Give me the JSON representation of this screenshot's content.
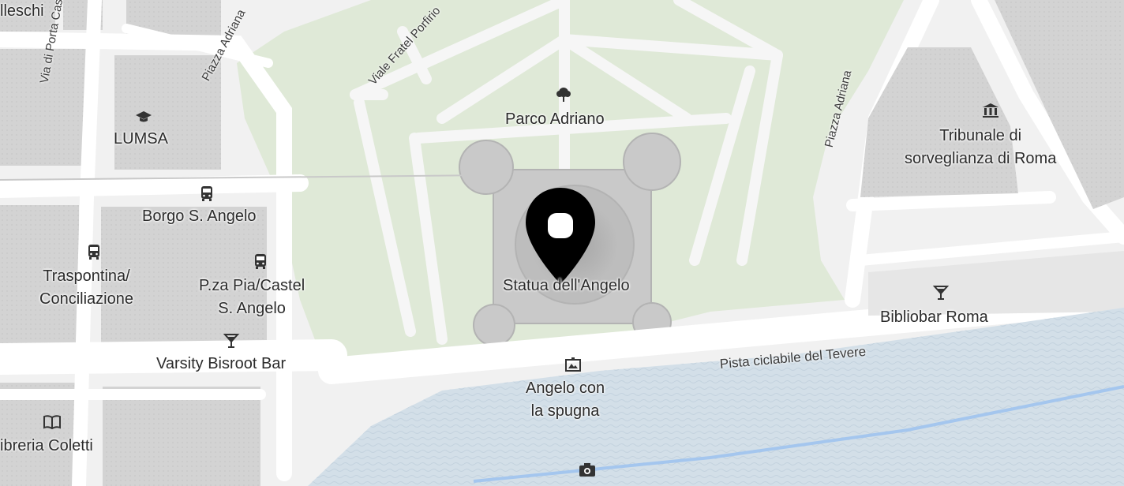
{
  "map": {
    "selected_place": "Statua dell'Angelo",
    "places": {
      "parco": "Parco Adriano",
      "statua": "Statua dell'Angelo",
      "lumsa": "LUMSA",
      "borgo": "Borgo S. Angelo",
      "traspontina": "Traspontina/\nConciliazione",
      "pzapia": "P.za Pia/Castel\nS. Angelo",
      "varsity": "Varsity Bisroot Bar",
      "angelo_spugna": "Angelo con\nla spugna",
      "libreria": "ibreria Coletti",
      "tribunale": "Tribunale di\nsorveglianza di Roma",
      "bibliobar": "Bibliobar Roma",
      "lleschi": "lleschi"
    },
    "roads": {
      "porta_castello": "Via di Porta Castello",
      "piazza_adriana_w": "Piazza Adriana",
      "fratel_porfirio": "Viale Fratel Porfirio",
      "piazza_adriana_e": "Piazza Adriana",
      "pista": "Pista ciclabile del Tevere"
    },
    "icons": {
      "park": "tree-icon",
      "university": "graduation-cap-icon",
      "bus": "bus-icon",
      "bar": "cocktail-icon",
      "monument": "monument-icon",
      "court": "government-building-icon",
      "library": "book-icon",
      "viewpoint": "camera-icon",
      "pin": "location-pin-icon"
    },
    "colors": {
      "park": "#dfe9d7",
      "water": "#d3dfe8",
      "road": "#ffffff",
      "building": "#d6d6d6",
      "pin": "#000000",
      "cycle": "#a4c6ee"
    }
  }
}
